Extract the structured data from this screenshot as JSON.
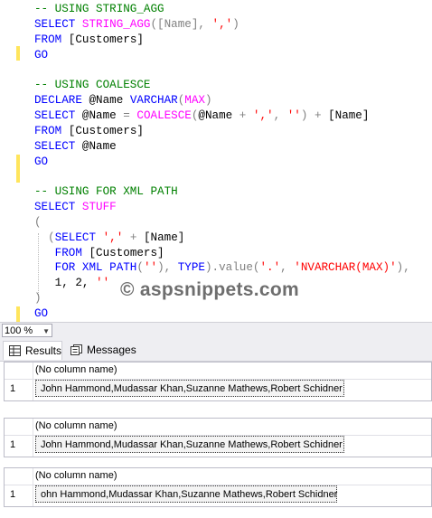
{
  "editor": {
    "lines": [
      [
        {
          "t": "-- USING STRING_AGG",
          "c": "#008000"
        }
      ],
      [
        {
          "t": "SELECT ",
          "c": "#0000ff"
        },
        {
          "t": "STRING_AGG",
          "c": "#ff00ff"
        },
        {
          "t": "([Name], ",
          "c": "#808080"
        },
        {
          "t": "','",
          "c": "#ff0000"
        },
        {
          "t": ")",
          "c": "#808080"
        }
      ],
      [
        {
          "t": "FROM ",
          "c": "#0000ff"
        },
        {
          "t": "[Customers]",
          "c": "#000000"
        }
      ],
      [
        {
          "t": "GO",
          "c": "#0000ff"
        }
      ],
      [],
      [
        {
          "t": "-- USING COALESCE",
          "c": "#008000"
        }
      ],
      [
        {
          "t": "DECLARE ",
          "c": "#0000ff"
        },
        {
          "t": "@Name ",
          "c": "#000000"
        },
        {
          "t": "VARCHAR",
          "c": "#0000ff"
        },
        {
          "t": "(",
          "c": "#808080"
        },
        {
          "t": "MAX",
          "c": "#ff00ff"
        },
        {
          "t": ")",
          "c": "#808080"
        }
      ],
      [
        {
          "t": "SELECT ",
          "c": "#0000ff"
        },
        {
          "t": "@Name ",
          "c": "#000000"
        },
        {
          "t": "= ",
          "c": "#808080"
        },
        {
          "t": "COALESCE",
          "c": "#ff00ff"
        },
        {
          "t": "(",
          "c": "#808080"
        },
        {
          "t": "@Name ",
          "c": "#000000"
        },
        {
          "t": "+ ",
          "c": "#808080"
        },
        {
          "t": "','",
          "c": "#ff0000"
        },
        {
          "t": ", ",
          "c": "#808080"
        },
        {
          "t": "''",
          "c": "#ff0000"
        },
        {
          "t": ") + ",
          "c": "#808080"
        },
        {
          "t": "[Name]",
          "c": "#000000"
        }
      ],
      [
        {
          "t": "FROM ",
          "c": "#0000ff"
        },
        {
          "t": "[Customers]",
          "c": "#000000"
        }
      ],
      [
        {
          "t": "SELECT ",
          "c": "#0000ff"
        },
        {
          "t": "@Name",
          "c": "#000000"
        }
      ],
      [
        {
          "t": "GO",
          "c": "#0000ff"
        }
      ],
      [],
      [
        {
          "t": "-- USING FOR XML PATH",
          "c": "#008000"
        }
      ],
      [
        {
          "t": "SELECT ",
          "c": "#0000ff"
        },
        {
          "t": "STUFF",
          "c": "#ff00ff"
        }
      ],
      [
        {
          "t": "(",
          "c": "#808080"
        }
      ],
      [
        {
          "t": "  (",
          "c": "#808080"
        },
        {
          "t": "SELECT ",
          "c": "#0000ff"
        },
        {
          "t": "','",
          "c": "#ff0000"
        },
        {
          "t": " + ",
          "c": "#808080"
        },
        {
          "t": "[Name]",
          "c": "#000000"
        }
      ],
      [
        {
          "t": "   FROM ",
          "c": "#0000ff"
        },
        {
          "t": "[Customers]",
          "c": "#000000"
        }
      ],
      [
        {
          "t": "   FOR XML PATH",
          "c": "#0000ff"
        },
        {
          "t": "(",
          "c": "#808080"
        },
        {
          "t": "''",
          "c": "#ff0000"
        },
        {
          "t": "), ",
          "c": "#808080"
        },
        {
          "t": "TYPE",
          "c": "#0000ff"
        },
        {
          "t": ").value(",
          "c": "#808080"
        },
        {
          "t": "'.'",
          "c": "#ff0000"
        },
        {
          "t": ", ",
          "c": "#808080"
        },
        {
          "t": "'NVARCHAR(MAX)'",
          "c": "#ff0000"
        },
        {
          "t": "),",
          "c": "#808080"
        }
      ],
      [
        {
          "t": "   1, 2, ",
          "c": "#000000"
        },
        {
          "t": "''",
          "c": "#ff0000"
        }
      ],
      [
        {
          "t": ")",
          "c": "#808080"
        }
      ],
      [
        {
          "t": "GO",
          "c": "#0000ff"
        }
      ]
    ]
  },
  "watermark": "© aspsnippets.com",
  "zoom": {
    "value": "100 %"
  },
  "tabs": {
    "results": "Results",
    "messages": "Messages"
  },
  "results": [
    {
      "header": "(No column name)",
      "row_number": "1",
      "value": "John Hammond,Mudassar Khan,Suzanne Mathews,Robert Schidner"
    },
    {
      "header": "(No column name)",
      "row_number": "1",
      "value": "John Hammond,Mudassar Khan,Suzanne Mathews,Robert Schidner"
    },
    {
      "header": "(No column name)",
      "row_number": "1",
      "value": "ohn Hammond,Mudassar Khan,Suzanne Mathews,Robert Schidner"
    }
  ],
  "colors": {
    "keyword": "#0000ff",
    "function": "#ff00ff",
    "string": "#ff0000",
    "comment": "#008000",
    "operator": "#808080",
    "change_marker": "#ffe55c"
  }
}
